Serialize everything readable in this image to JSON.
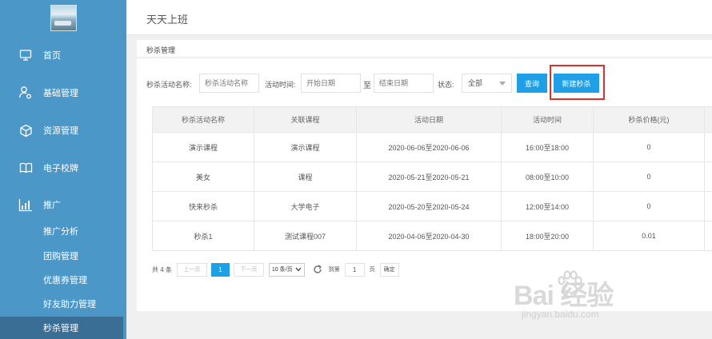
{
  "sidebar": {
    "items": [
      {
        "label": "首页",
        "icon": "monitor-icon"
      },
      {
        "label": "基础管理",
        "icon": "user-gear-icon"
      },
      {
        "label": "资源管理",
        "icon": "cube-icon"
      },
      {
        "label": "电子校牌",
        "icon": "book-icon"
      },
      {
        "label": "推广",
        "icon": "bar-chart-icon"
      }
    ],
    "sub_items": [
      {
        "label": "推广分析"
      },
      {
        "label": "团购管理"
      },
      {
        "label": "优惠券管理"
      },
      {
        "label": "好友助力管理"
      },
      {
        "label": "秒杀管理"
      }
    ]
  },
  "header": {
    "title": "天天上班"
  },
  "breadcrumb": {
    "current": "秒杀管理"
  },
  "filters": {
    "name_label": "秒杀活动名称:",
    "name_placeholder": "秒杀活动名称",
    "time_label": "活动时间:",
    "start_placeholder": "开始日期",
    "to_text": "至",
    "end_placeholder": "结束日期",
    "status_label": "状态:",
    "status_value": "全部",
    "query_label": "查询",
    "new_label": "新建秒杀"
  },
  "table": {
    "columns": [
      "秒杀活动名称",
      "关联课程",
      "活动日期",
      "活动时间",
      "秒杀价格(元)"
    ],
    "rows": [
      [
        "演示课程",
        "演示课程",
        "2020-06-06至2020-06-06",
        "16:00至18:00",
        "0"
      ],
      [
        "美女",
        "课程",
        "2020-05-21至2020-05-21",
        "08:00至10:00",
        "0"
      ],
      [
        "快来秒杀",
        "大学电子",
        "2020-05-20至2020-05-24",
        "12:00至14:00",
        "0"
      ],
      [
        "秒杀1",
        "测试课程007",
        "2020-04-06至2020-04-30",
        "18:00至20:00",
        "0.01"
      ]
    ]
  },
  "pager": {
    "total": "共 4 条",
    "prev": "上一页",
    "current": "1",
    "next": "下一页",
    "page_size": "10 条/页",
    "goto": "到第",
    "page_input": "1",
    "page_unit": "页",
    "confirm": "确定"
  },
  "watermark": {
    "brand": "Bai 经验",
    "url": "jingyan.baidu.com"
  },
  "colors": {
    "sidebar": "#4a97c8",
    "sidebar_active": "#3a6e95",
    "accent": "#1e9fe6",
    "highlight": "#d9302b"
  }
}
